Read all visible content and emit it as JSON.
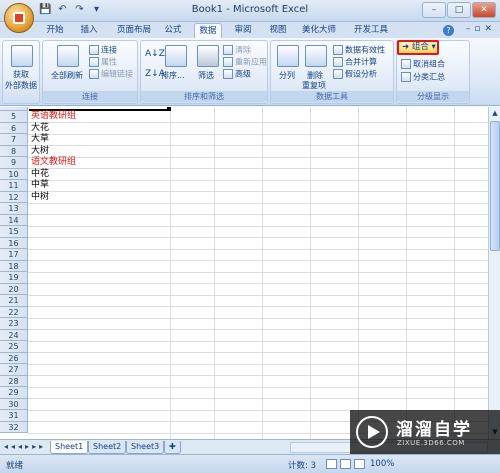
{
  "window": {
    "title": "Book1 - Microsoft Excel",
    "controls": [
      "–",
      "□",
      "✕"
    ]
  },
  "qat_icons": [
    "save-icon",
    "undo-icon",
    "redo-icon",
    "customize-icon"
  ],
  "tabs": [
    {
      "label": "开始"
    },
    {
      "label": "插入"
    },
    {
      "label": "页面布局"
    },
    {
      "label": "公式"
    },
    {
      "label": "数据",
      "active": true
    },
    {
      "label": "审阅"
    },
    {
      "label": "视图"
    },
    {
      "label": "美化大师"
    },
    {
      "label": "开发工具"
    }
  ],
  "ribbon": {
    "get_external": {
      "line1": "获取",
      "line2": "外部数据"
    },
    "connections": {
      "label": "连接",
      "refresh_all": "全部刷新",
      "items": [
        "连接",
        "属性",
        "编辑链接"
      ]
    },
    "sort_filter": {
      "label": "排序和筛选",
      "sort": "排序...",
      "filter": "筛选",
      "items": [
        "清除",
        "重新应用",
        "高级"
      ]
    },
    "data_tools": {
      "label": "数据工具",
      "split": "分列",
      "remove_dup_line1": "删除",
      "remove_dup_line2": "重复项",
      "items": [
        "数据有效性",
        "合并计算",
        "假设分析"
      ]
    },
    "outline": {
      "label": "分级显示",
      "group": "组合",
      "ungroup": "取消组合",
      "subtotal": "分类汇总"
    }
  },
  "rows": [
    {
      "num": "5",
      "a": "英语教研组",
      "red": true
    },
    {
      "num": "6",
      "a": "大花"
    },
    {
      "num": "7",
      "a": "大草"
    },
    {
      "num": "8",
      "a": "大树"
    },
    {
      "num": "9",
      "a": "语文教研组",
      "red": true
    },
    {
      "num": "10",
      "a": "中花"
    },
    {
      "num": "11",
      "a": "中草"
    },
    {
      "num": "12",
      "a": "中树"
    },
    {
      "num": "13",
      "a": ""
    },
    {
      "num": "14",
      "a": ""
    },
    {
      "num": "15",
      "a": ""
    },
    {
      "num": "16",
      "a": ""
    },
    {
      "num": "17",
      "a": ""
    },
    {
      "num": "18",
      "a": ""
    },
    {
      "num": "19",
      "a": ""
    },
    {
      "num": "20",
      "a": ""
    },
    {
      "num": "21",
      "a": ""
    },
    {
      "num": "22",
      "a": ""
    },
    {
      "num": "23",
      "a": ""
    },
    {
      "num": "24",
      "a": ""
    },
    {
      "num": "25",
      "a": ""
    },
    {
      "num": "26",
      "a": ""
    },
    {
      "num": "27",
      "a": ""
    },
    {
      "num": "28",
      "a": ""
    },
    {
      "num": "29",
      "a": ""
    },
    {
      "num": "30",
      "a": ""
    },
    {
      "num": "31",
      "a": ""
    },
    {
      "num": "32",
      "a": ""
    }
  ],
  "sheets": [
    {
      "label": "Sheet1",
      "active": true
    },
    {
      "label": "Sheet2"
    },
    {
      "label": "Sheet3"
    }
  ],
  "status": {
    "ready": "就绪",
    "count": "计数: 3",
    "zoom": "100%"
  },
  "watermark": {
    "title": "溜溜自学",
    "url": "ZIXUE.3D66.COM"
  }
}
